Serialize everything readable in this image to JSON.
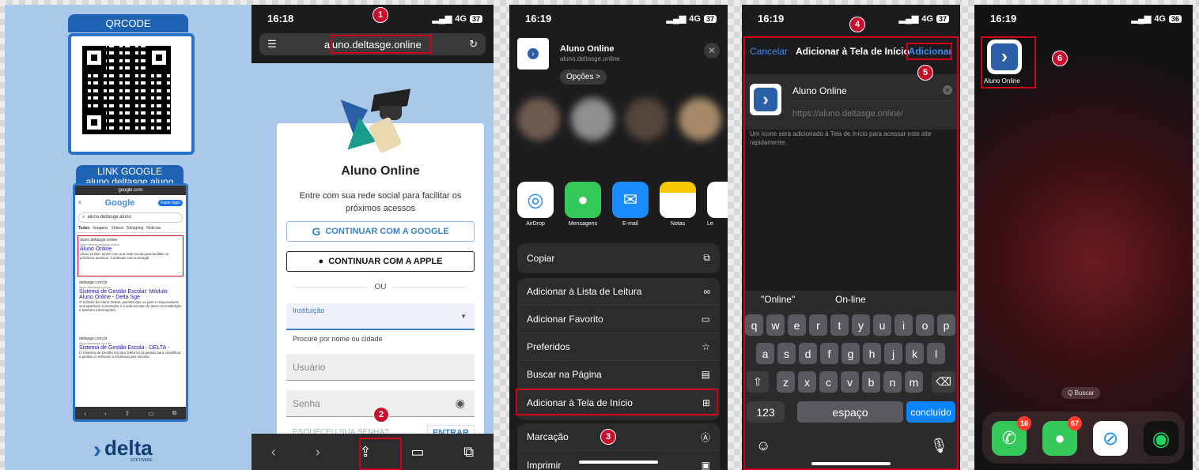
{
  "panel1": {
    "qrcode_title": "QRCODE",
    "link_title": "LINK GOOGLE",
    "link_text": "aluno.deltasge.aluno",
    "google": {
      "url": "google.com",
      "logo": "Google",
      "login": "Fazer login",
      "query": "aluno.deltasge.aluno",
      "tabs": [
        "Todas",
        "Imagens",
        "Vídeos",
        "Shopping",
        "Notícias"
      ],
      "results": [
        {
          "site": "aluno.deltasge.online",
          "url": "https://aluno.deltasge.online",
          "title": "Aluno Online",
          "desc": "Aluno Online. Entre com sua rede social para facilitar os próximos acessos. Continuar com a Google."
        },
        {
          "site": "deltasge.com.br",
          "url": "https://deltasge.com.br",
          "title": "Sistema de Gestão Escolar: Módulo Aluno Online - Delta Sge",
          "desc": "O módulo do Aluno Online, permite que os pais e responsáveis acompanhem a evolução e a vida escolar do aluno na instituição e também informações..."
        },
        {
          "site": "deltasge.com.br",
          "url": "https://deltasge.com.br",
          "title": "Sistema de Gestão Escola - DELTA -",
          "desc": "O Sistema de Gestão Escolar Delta foi projetado para simplificar a gestão e melhorar a eficiência das escolas"
        }
      ]
    },
    "brand": "delta",
    "brand_sub": "SOFTWARE"
  },
  "panel2": {
    "time": "16:18",
    "network": "4G",
    "battery": "37",
    "url": "aluno.deltasge.online",
    "app_title": "Aluno Online",
    "subtitle": "Entre com sua rede social para facilitar os próximos acessos",
    "google_btn": "CONTINUAR COM A GOOGLE",
    "apple_btn": "CONTINUAR COM A APPLE",
    "or": "OU",
    "institution_label": "Instituição",
    "institution_hint": "Procure por nome ou cidade",
    "user_placeholder": "Usuário",
    "password_placeholder": "Senha",
    "forgot": "ESQUECEU SUA SENHA?",
    "enter": "ENTRAR"
  },
  "panel3": {
    "time": "16:19",
    "network": "4G",
    "battery": "37",
    "app_name": "Aluno Online",
    "app_url": "aluno.deltasge.online",
    "options": "Opções >",
    "apps": [
      "AirDrop",
      "Mensagens",
      "E-mail",
      "Notas",
      "Le"
    ],
    "copy": "Copiar",
    "actions": [
      "Adicionar à Lista de Leitura",
      "Adicionar Favorito",
      "Preferidos",
      "Buscar na Página",
      "Adicionar à Tela de Início"
    ],
    "more": [
      "Marcação",
      "Imprimir"
    ]
  },
  "panel4": {
    "time": "16:19",
    "network": "4G",
    "battery": "37",
    "cancel": "Cancelar",
    "title": "Adicionar à Tela de Início",
    "add": "Adicionar",
    "name": "Aluno Online",
    "url": "https://aluno.deltasge.online/",
    "note": "Um ícone será adicionado à Tela de Início para acessar este site rapidamente.",
    "suggestions": [
      "\"Online\"",
      "On-line"
    ],
    "row1": [
      "q",
      "w",
      "e",
      "r",
      "t",
      "y",
      "u",
      "i",
      "o",
      "p"
    ],
    "row2": [
      "a",
      "s",
      "d",
      "f",
      "g",
      "h",
      "j",
      "k",
      "l"
    ],
    "row3": [
      "z",
      "x",
      "c",
      "v",
      "b",
      "n",
      "m"
    ],
    "num": "123",
    "space": "espaço",
    "done": "concluído"
  },
  "panel5": {
    "time": "16:19",
    "network": "4G",
    "battery": "36",
    "app_label": "Aluno Online",
    "search": "Q Buscar",
    "phone_badge": "16",
    "messages_badge": "67"
  },
  "markers": [
    "1",
    "2",
    "3",
    "4",
    "5",
    "6"
  ]
}
